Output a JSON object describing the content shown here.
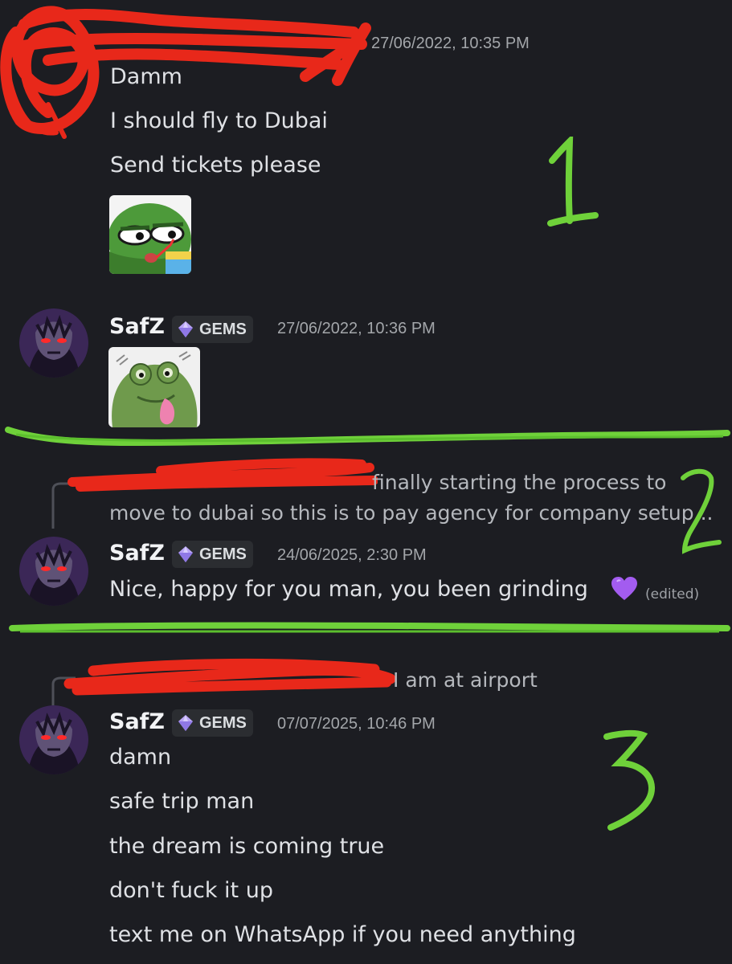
{
  "messages": [
    {
      "timestamp": "27/06/2022, 10:35 PM",
      "lines": [
        "Damm",
        "I should fly to Dubai",
        "Send tickets please"
      ],
      "sticker": "pepe-drinking-sticker"
    },
    {
      "author": "SafZ",
      "tag": "GEMS",
      "timestamp": "27/06/2022, 10:36 PM",
      "sticker": "frog-tongue-sticker"
    },
    {
      "reply_preview": [
        "finally starting the process to",
        "move to dubai so this is to pay agency for company setup..."
      ],
      "author": "SafZ",
      "tag": "GEMS",
      "timestamp": "24/06/2025, 2:30 PM",
      "text": "Nice, happy for you man, you been grinding",
      "emoji": "purple-heart-icon",
      "edited": "(edited)"
    },
    {
      "reply_preview": "I am at airport",
      "author": "SafZ",
      "tag": "GEMS",
      "timestamp": "07/07/2025, 10:46 PM",
      "lines": [
        "damn",
        "safe trip man",
        "the dream is coming true",
        "don't fuck it up",
        "text me on WhatsApp if you need anything"
      ]
    }
  ],
  "annotations": [
    "1",
    "2",
    "3"
  ],
  "colors": {
    "background": "#1c1d22",
    "redaction": "#e8281a",
    "annotation": "#6fd13a",
    "heart": "#a35cf0",
    "gem": "#b9a5f5"
  }
}
